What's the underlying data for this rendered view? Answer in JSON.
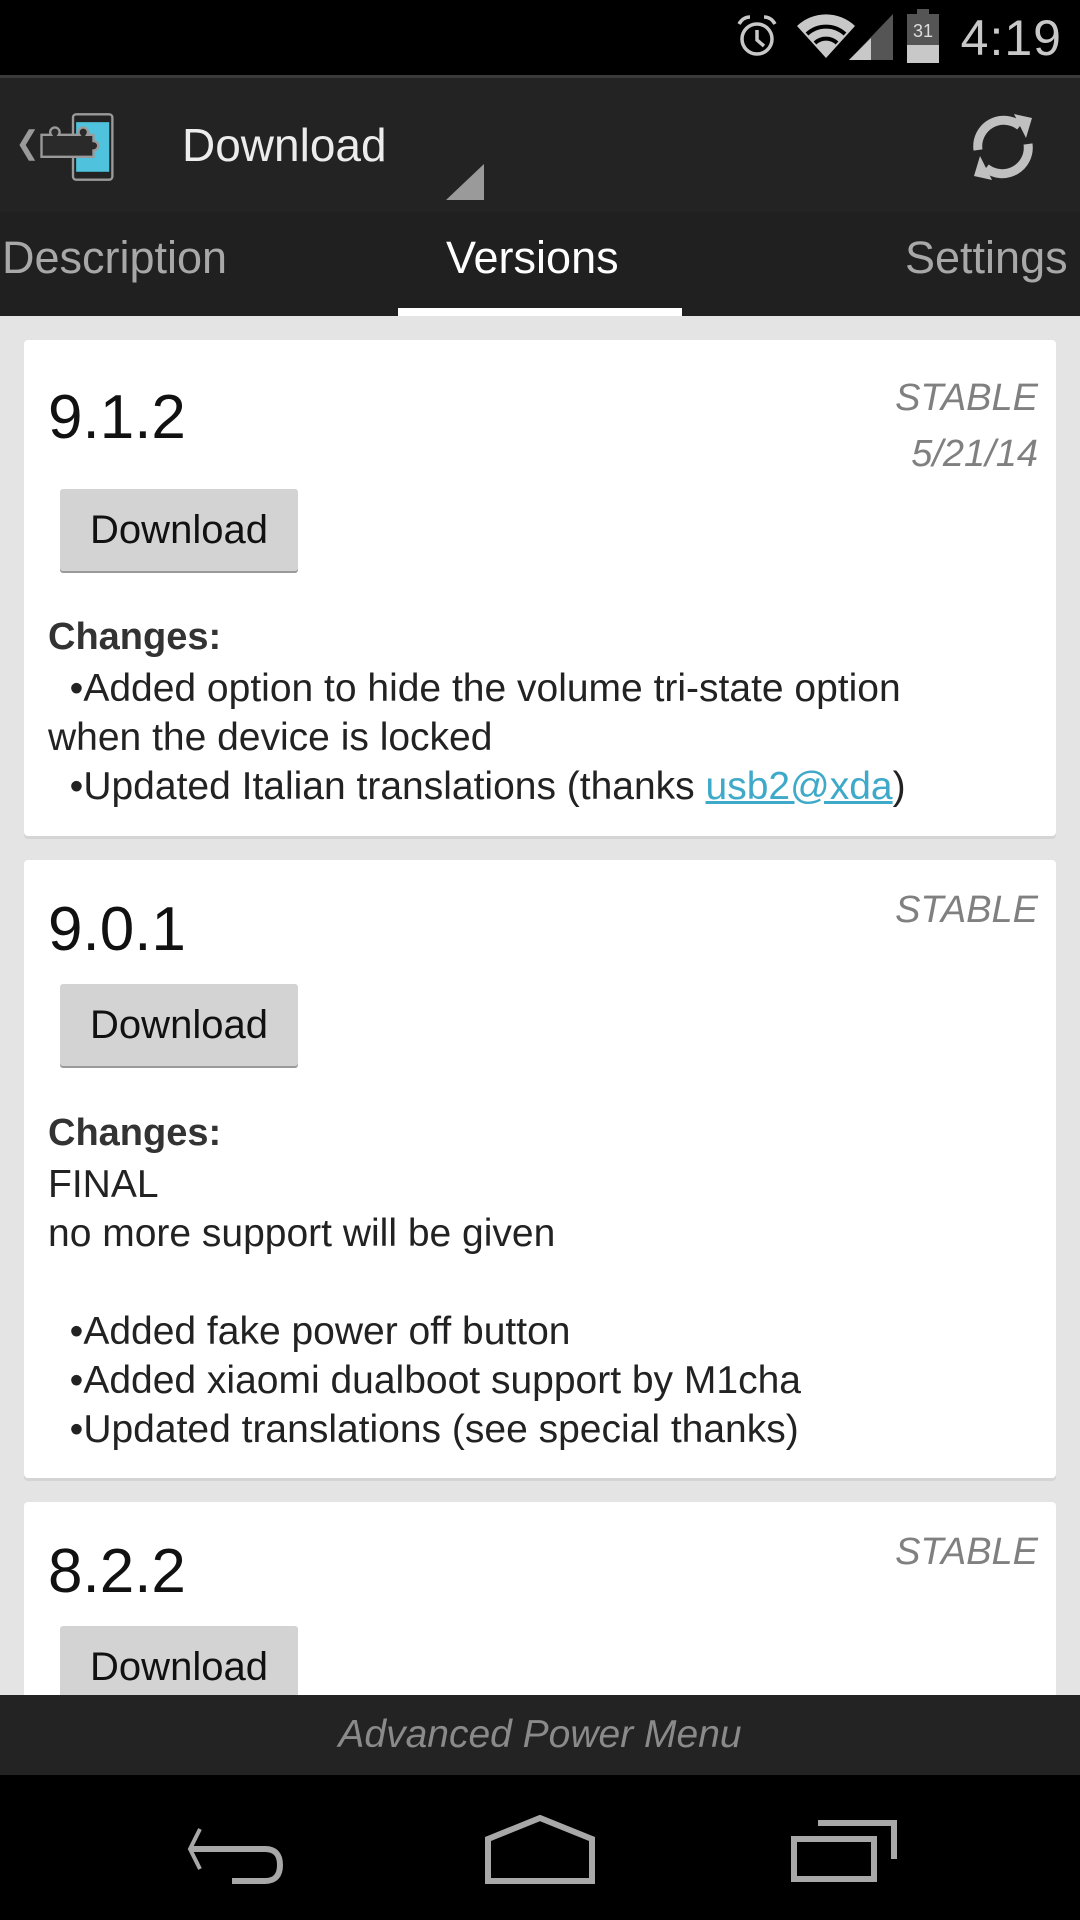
{
  "status_bar": {
    "time": "4:19",
    "battery_level": "31",
    "icons": [
      "alarm-icon",
      "wifi-icon",
      "signal-icon",
      "battery-icon"
    ]
  },
  "action_bar": {
    "title": "Download",
    "app_icon": "xposed-puzzle-icon",
    "refresh_icon": "refresh-icon"
  },
  "tabs": [
    {
      "label": "Description",
      "selected": false
    },
    {
      "label": "Versions",
      "selected": true
    },
    {
      "label": "Settings",
      "selected": false
    }
  ],
  "versions": [
    {
      "version": "9.1.2",
      "channel": "STABLE",
      "date": "5/21/14",
      "download_label": "Download",
      "changes_title": "Changes:",
      "changes": {
        "line1": "Added option to hide the volume tri-state option",
        "line2": "when the device is locked",
        "line3_prefix": "Updated Italian translations (thanks ",
        "line3_link": "usb2@xda",
        "line3_suffix": ")"
      }
    },
    {
      "version": "9.0.1",
      "channel": "STABLE",
      "download_label": "Download",
      "changes_title": "Changes:",
      "changes": {
        "line1": "FINAL",
        "line2": "no more support will be given",
        "bullets": [
          "Added fake power off button",
          "Added xiaomi dualboot support by M1cha",
          "Updated translations (see special thanks)"
        ]
      }
    },
    {
      "version": "8.2.2",
      "channel": "STABLE",
      "download_label": "Download"
    }
  ],
  "footer": {
    "module_name": "Advanced Power Menu"
  },
  "nav_bar": {
    "back": "back-icon",
    "home": "home-icon",
    "recents": "recents-icon"
  },
  "colors": {
    "accent_link": "#3fa9c9",
    "app_icon_screen": "#4fc3dd",
    "bar_bg": "#232323",
    "content_bg": "#e4e4e4"
  }
}
